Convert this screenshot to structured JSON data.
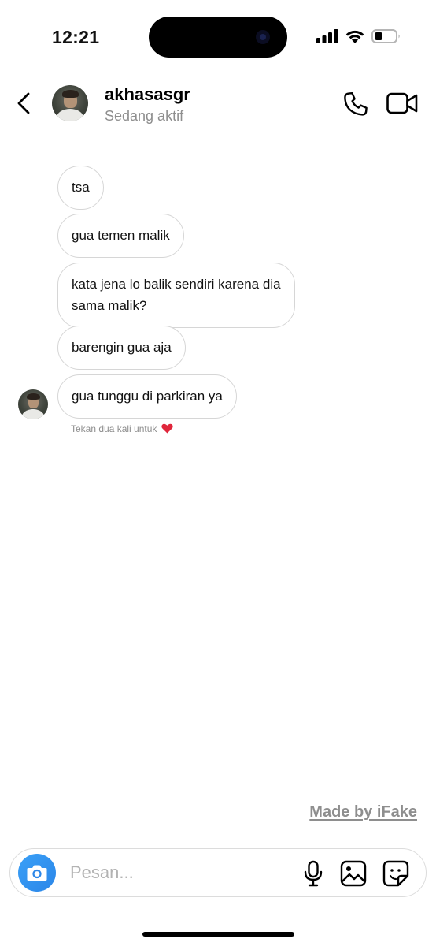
{
  "status_bar": {
    "time": "12:21"
  },
  "header": {
    "back_icon": "chevron-left-icon",
    "avatar_icon": "profile-photo",
    "username": "akhasasgr",
    "presence": "Sedang aktif",
    "call_icon": "phone-icon",
    "video_icon": "video-camera-icon"
  },
  "messages": [
    {
      "text": "tsa"
    },
    {
      "text": "gua temen malik"
    },
    {
      "text": "kata jena lo balik sendiri karena dia\nsama malik?"
    },
    {
      "text": "barengin gua aja"
    },
    {
      "text": "gua tunggu di parkiran ya"
    }
  ],
  "double_tap_hint": "Tekan dua kali untuk",
  "hint_icon": "heart-icon",
  "watermark": "Made by iFake",
  "composer": {
    "placeholder": "Pesan...",
    "camera_icon": "camera-icon",
    "mic_icon": "microphone-icon",
    "gallery_icon": "image-icon",
    "sticker_icon": "sticker-icon"
  },
  "colors": {
    "bubble_border": "#d6d6d6",
    "secondary_text": "#8e8e8e",
    "camera_button": "#2b86e8",
    "heart": "#e0263b"
  }
}
